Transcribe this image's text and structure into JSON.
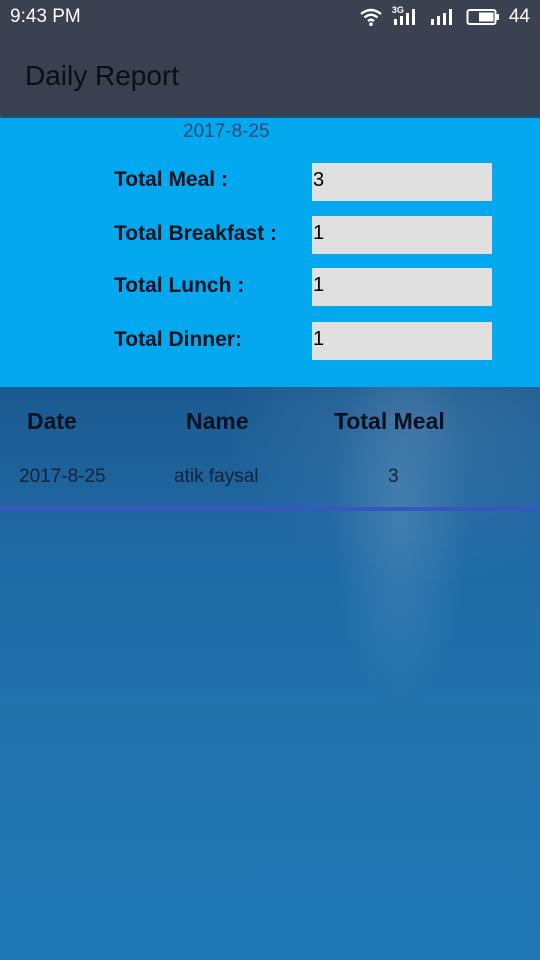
{
  "status_bar": {
    "time": "9:43 PM",
    "network_label": "3G",
    "battery": "44"
  },
  "app_bar": {
    "title": "Daily Report"
  },
  "summary": {
    "date": "2017-8-25",
    "rows": [
      {
        "label": "Total Meal :",
        "value": "3"
      },
      {
        "label": "Total Breakfast :",
        "value": "1"
      },
      {
        "label": "Total Lunch :",
        "value": "1"
      },
      {
        "label": "Total Dinner:",
        "value": "1"
      }
    ]
  },
  "table": {
    "headers": [
      "Date",
      "Name",
      "Total Meal"
    ],
    "rows": [
      [
        "2017-8-25",
        "atik faysal",
        "3"
      ]
    ]
  },
  "colors": {
    "status_bar": "#3a4150",
    "app_bar": "#394150",
    "summary_bg": "#03a8ee",
    "field_bg": "#e0e0e0",
    "divider": "#3b54c2"
  }
}
